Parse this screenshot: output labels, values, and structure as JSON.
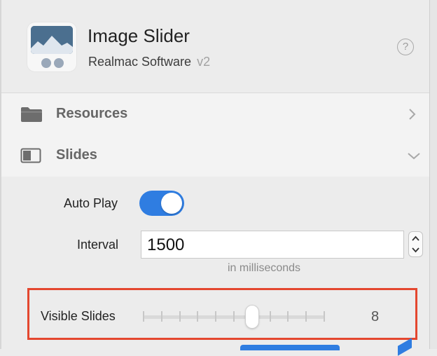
{
  "header": {
    "title": "Image Slider",
    "publisher": "Realmac Software",
    "version": "v2",
    "help_icon": "question-circle-icon"
  },
  "sections": [
    {
      "label": "Resources",
      "icon": "folder-icon",
      "state": "collapsed"
    },
    {
      "label": "Slides",
      "icon": "slides-panel-icon",
      "state": "expanded"
    }
  ],
  "slides": {
    "auto_play_label": "Auto Play",
    "auto_play_on": true,
    "interval_label": "Interval",
    "interval_value": "1500",
    "interval_hint": "in milliseconds",
    "visible_slides_label": "Visible Slides",
    "visible_slides_value": "8",
    "visible_slides_fraction": 0.6
  },
  "colors": {
    "accent": "#2f7de1",
    "highlight": "#e4472f"
  }
}
